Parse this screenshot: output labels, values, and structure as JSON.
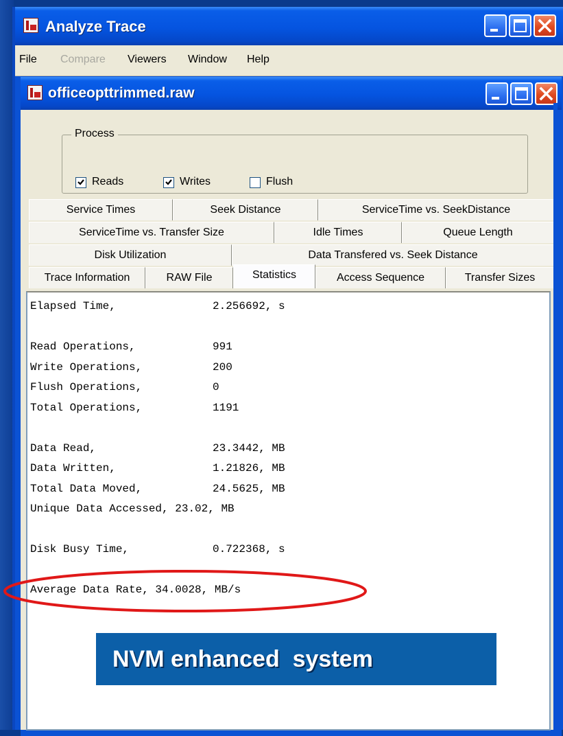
{
  "app_window": {
    "title": "Analyze Trace"
  },
  "menu": {
    "items": [
      {
        "label": "File",
        "enabled": true
      },
      {
        "label": "Compare",
        "enabled": false
      },
      {
        "label": "Viewers",
        "enabled": true
      },
      {
        "label": "Window",
        "enabled": true
      },
      {
        "label": "Help",
        "enabled": true
      }
    ]
  },
  "child_window": {
    "title": "officeopttrimmed.raw"
  },
  "process_group": {
    "label": "Process",
    "options": [
      {
        "label": "Reads",
        "checked": true
      },
      {
        "label": "Writes",
        "checked": true
      },
      {
        "label": "Flush",
        "checked": false
      }
    ]
  },
  "tabs": {
    "row1": [
      "Service Times",
      "Seek Distance",
      "ServiceTime vs. SeekDistance"
    ],
    "row2": [
      "ServiceTime  vs. Transfer Size",
      "Idle Times",
      "Queue Length"
    ],
    "row3": [
      "Disk Utilization",
      "Data Transfered vs. Seek Distance"
    ],
    "row4": [
      "Trace Information",
      "RAW File",
      "Statistics",
      "Access Sequence",
      "Transfer Sizes"
    ],
    "active": "Statistics"
  },
  "statistics": [
    {
      "name": "Elapsed Time,",
      "value": "2.256692, s"
    },
    {
      "name": "Read Operations,",
      "value": "991"
    },
    {
      "name": "Write Operations,",
      "value": "200"
    },
    {
      "name": "Flush Operations,",
      "value": "0"
    },
    {
      "name": "Total Operations,",
      "value": "1191"
    },
    {
      "name": "Data Read,",
      "value": "23.3442, MB"
    },
    {
      "name": "Data Written,",
      "value": "1.21826, MB"
    },
    {
      "name": "Total Data Moved,",
      "value": "24.5625, MB"
    },
    {
      "line": "Unique Data Accessed, 23.02, MB"
    },
    {
      "name": "Disk Busy Time,",
      "value": "0.722368, s"
    },
    {
      "line": "Average Data Rate, 34.0028, MB/s"
    }
  ],
  "callout": {
    "text": "NVM enhanced  system"
  },
  "colors": {
    "titlebar": "#0554e0",
    "highlight_ellipse": "#e01818",
    "callout_bg": "#0c5fa8"
  }
}
